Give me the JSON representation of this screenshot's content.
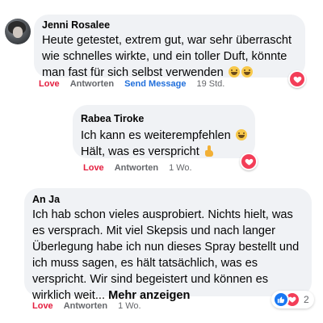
{
  "comments": [
    {
      "author": "Jenni Rosalee",
      "text": "Heute getestet, extrem gut, war sehr überrascht wie schnelles wirkte, und ein toller Duft, könnte man fast für sich selbst verwenden",
      "emojis": [
        "grinning-face",
        "grinning-face-sweat"
      ],
      "actions": {
        "love": "Love",
        "reply": "Antworten",
        "send_message": "Send Message",
        "time": "19 Std."
      },
      "reaction": "heart"
    },
    {
      "author": "Rabea Tiroke",
      "line1": "Ich kann es weiterempfehlen",
      "line2": "Hält, was es verspricht",
      "emojis": [
        "grinning-face",
        "thumbs-up"
      ],
      "actions": {
        "love": "Love",
        "reply": "Antworten",
        "time": "1 Wo."
      },
      "reaction": "heart"
    },
    {
      "author": "An Ja",
      "text": "Ich hab schon vieles ausprobiert. Nichts hielt, was es versprach. Mit viel Skepsis und nach langer Überlegung habe ich nun dieses Spray bestellt und ich muss sagen, es hält tatsächlich, was es verspricht. Wir sind begeistert und können es wirklich weit...",
      "more": "Mehr anzeigen",
      "actions": {
        "love": "Love",
        "reply": "Antworten",
        "time": "1 Wo."
      },
      "reactions": [
        "like",
        "heart"
      ],
      "reaction_count": "2"
    }
  ],
  "colors": {
    "love": "#e41e3f",
    "send_message": "#216fdb",
    "bubble": "#f0f2f5",
    "heart": "#f33e58",
    "like": "#1877f2"
  }
}
